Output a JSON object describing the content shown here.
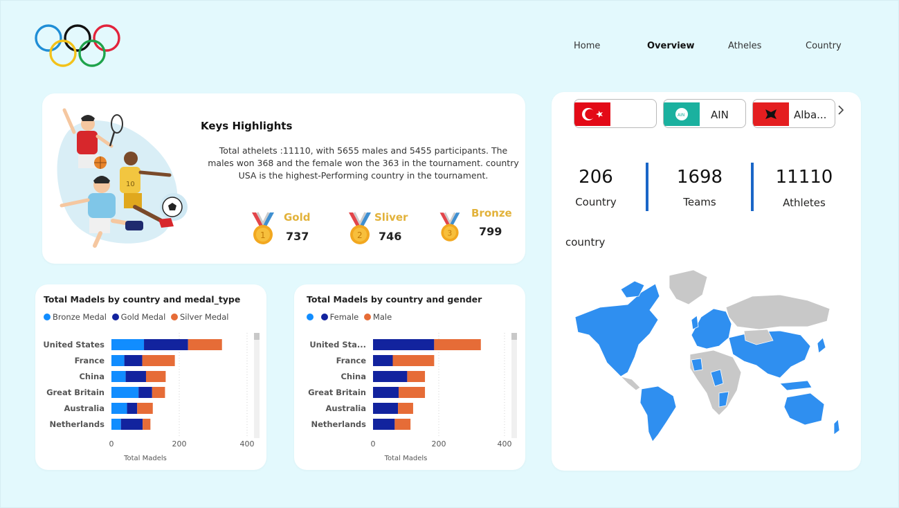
{
  "nav": {
    "items": [
      {
        "label": "Home",
        "active": false
      },
      {
        "label": "Overview",
        "active": true
      },
      {
        "label": "Atheles",
        "active": false
      },
      {
        "label": "Country",
        "active": false
      }
    ]
  },
  "highlights": {
    "title": "Keys Highlights",
    "description": "Total athelets :11110, with 5655 males and 5455 participants. The males won 368 and the female won the 363 in the tournament. country USA is the highest-Performing country in the tournament.",
    "medals": [
      {
        "label": "Gold",
        "count": "737",
        "icon": "medal-1-icon"
      },
      {
        "label": "Sliver",
        "count": "746",
        "icon": "medal-2-icon"
      },
      {
        "label": "Bronze",
        "count": "799",
        "icon": "medal-3-icon"
      }
    ]
  },
  "country_slicer": {
    "items": [
      {
        "label": "",
        "flag": "turkey-flag-icon"
      },
      {
        "label": "AIN",
        "flag": "ain-flag-icon"
      },
      {
        "label": "Alba...",
        "flag": "albania-flag-icon"
      }
    ]
  },
  "stats": [
    {
      "value": "206",
      "label": "Country"
    },
    {
      "value": "1698",
      "label": "Teams"
    },
    {
      "value": "11110",
      "label": "Athletes"
    }
  ],
  "map": {
    "title": "country"
  },
  "colors": {
    "bronze": "#118dff",
    "gold": "#12239e",
    "silver": "#e66c37",
    "accent_blue": "#1a66c7",
    "medal_gold": "#e2b23a",
    "map_highlight": "#2f8ff0",
    "map_other": "#c8c8c8"
  },
  "chart_data": [
    {
      "type": "bar",
      "orientation": "horizontal-stacked",
      "title": "Total Madels by country and medal_type",
      "legend": [
        "Bronze Medal",
        "Gold Medal",
        "Silver Medal"
      ],
      "categories": [
        "United States",
        "France",
        "China",
        "Great Britain",
        "Australia",
        "Netherlands"
      ],
      "series": [
        {
          "name": "Bronze Medal",
          "values": [
            96,
            38,
            42,
            80,
            46,
            28
          ]
        },
        {
          "name": "Gold Medal",
          "values": [
            130,
            53,
            60,
            40,
            30,
            64
          ]
        },
        {
          "name": "Silver Medal",
          "values": [
            100,
            96,
            58,
            38,
            46,
            23
          ]
        }
      ],
      "xlabel": "Total Madels",
      "xticks": [
        "0",
        "200",
        "400"
      ],
      "xlim": [
        0,
        400
      ]
    },
    {
      "type": "bar",
      "orientation": "horizontal-stacked",
      "title": "Total Madels by country and gender",
      "legend": [
        "",
        "Female",
        "Male"
      ],
      "categories": [
        "United Sta...",
        "France",
        "China",
        "Great Britain",
        "Australia",
        "Netherlands"
      ],
      "series": [
        {
          "name": "Female",
          "values": [
            186,
            60,
            104,
            78,
            76,
            66
          ]
        },
        {
          "name": "Male",
          "values": [
            142,
            126,
            54,
            80,
            46,
            48
          ]
        }
      ],
      "xlabel": "Total Madels",
      "xticks": [
        "0",
        "200",
        "400"
      ],
      "xlim": [
        0,
        400
      ]
    }
  ]
}
